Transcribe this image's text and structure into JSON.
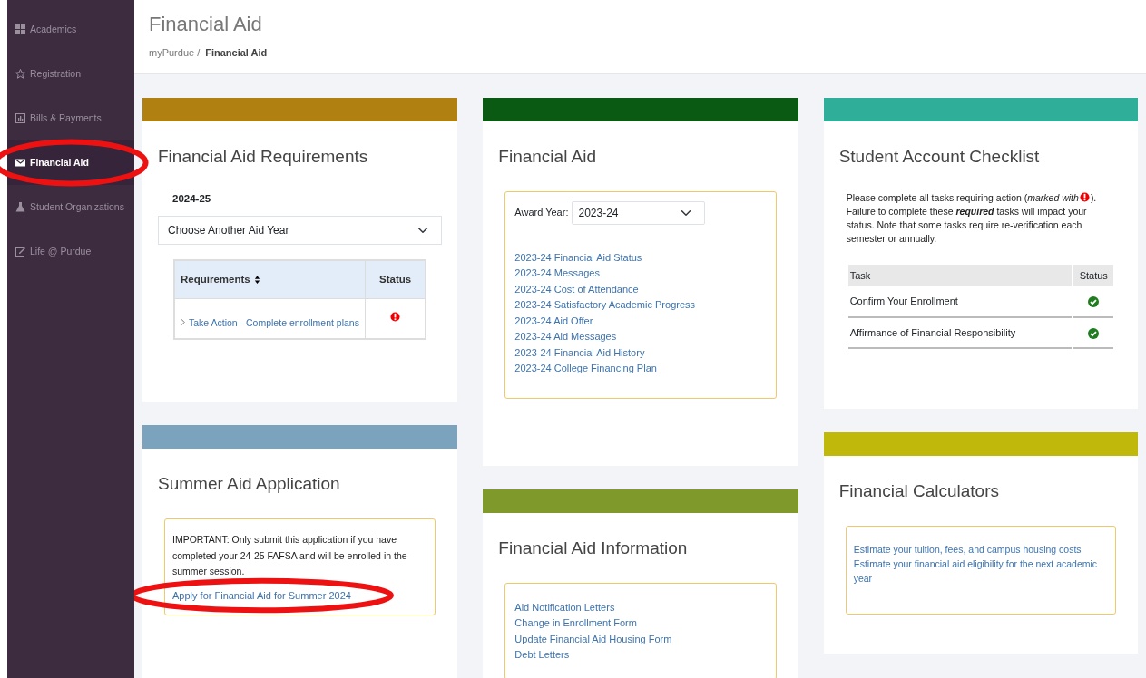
{
  "sidebar": {
    "items": [
      {
        "label": "Academics",
        "selected": false,
        "circled": false
      },
      {
        "label": "Registration",
        "selected": false,
        "circled": false
      },
      {
        "label": "Bills & Payments",
        "selected": false,
        "circled": false
      },
      {
        "label": "Financial Aid",
        "selected": true,
        "circled": true
      },
      {
        "label": "Student Organizations",
        "selected": false,
        "circled": false
      },
      {
        "label": "Life @ Purdue",
        "selected": false,
        "circled": false
      }
    ]
  },
  "header": {
    "title": "Financial Aid",
    "breadcrumb": [
      {
        "label": "myPurdue /",
        "current": false
      },
      {
        "label": "Financial Aid",
        "current": true
      }
    ]
  },
  "columns": [
    [
      {
        "kind": "requirements",
        "color": "#b08110",
        "title": "Financial Aid Requirements",
        "year": "2024-25",
        "select": {
          "value": "Choose Another Aid Year"
        },
        "table": {
          "columns": [
            "Requirements",
            "Status"
          ],
          "rows": [
            {
              "task": "Take Action - Complete enrollment plans",
              "complete": false
            }
          ]
        }
      },
      {
        "kind": "summer",
        "color": "#7ba3bd",
        "title": "Summer Aid Application",
        "notice": "IMPORTANT: Only submit this application if you have completed your 24-25 FAFSA and will be enrolled in the summer session.",
        "link": {
          "label": "Apply for Financial Aid for Summer 2024",
          "circled": true
        }
      }
    ],
    [
      {
        "kind": "aid",
        "color": "#0b5a14",
        "title": "Financial Aid",
        "award_label": "Award Year:",
        "select": {
          "value": "2023-24"
        },
        "links": [
          "2023-24 Financial Aid Status",
          "2023-24 Messages",
          "2023-24 Cost of Attendance",
          "2023-24 Satisfactory Academic Progress",
          "2023-24 Aid Offer",
          "2023-24 Aid Messages",
          "2023-24 Financial Aid History",
          "2023-24 College Financing Plan"
        ]
      },
      {
        "kind": "info",
        "color": "#7f9a2a",
        "title": "Financial Aid Information",
        "links": [
          "Aid Notification Letters",
          "Change in Enrollment Form",
          "Update Financial Aid Housing Form",
          "Debt Letters"
        ]
      }
    ],
    [
      {
        "kind": "checklist",
        "color": "#2fae9a",
        "title": "Student Account Checklist",
        "intro_before": "Please complete all tasks requiring action (*marked with*",
        "intro_after": "). Failure to complete these **required** tasks will impact your status. Note that some tasks require re-verification each semester or annually.",
        "table": {
          "columns": [
            "Task",
            "Status"
          ],
          "rows": [
            {
              "task": "Confirm Your Enrollment",
              "complete": true
            },
            {
              "task": "Affirmance of Financial Responsibility",
              "complete": true
            }
          ]
        }
      },
      {
        "kind": "calculators",
        "color": "#c0b90c",
        "title": "Financial Calculators",
        "links": [
          "Estimate your tuition, fees, and campus housing costs",
          "Estimate your financial aid eligibility for the next academic year"
        ]
      }
    ]
  ]
}
